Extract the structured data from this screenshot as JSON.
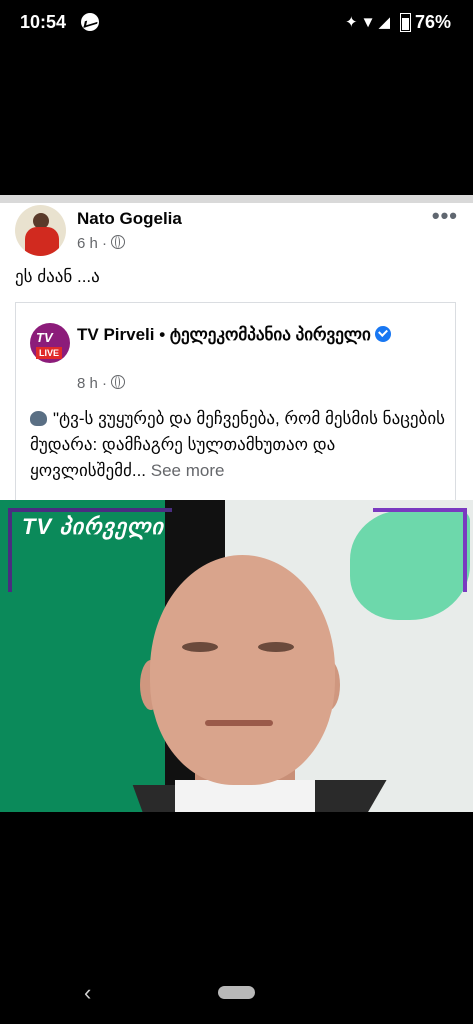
{
  "status_bar": {
    "time": "10:54",
    "battery": "76%"
  },
  "post": {
    "author": "Nato Gogelia",
    "time": "6 h ·",
    "text": "ეს ძაან ...ა",
    "shared": {
      "page_name": "TV Pirveli • ტელეკომპანია პირველი",
      "time": "8 h ·",
      "text": "\"ტვ-ს ვუყურებ და მეჩვენება, რომ მესმის ნაცების მუდარა: დამჩაგრე სულთამხუთაო და ყოვლისშემძ...",
      "see_more": "See more",
      "avatar_text": "TV",
      "avatar_badge": "LIVE"
    }
  },
  "photo": {
    "logo_text": "TV პირველი"
  },
  "nav": {
    "back_glyph": "‹"
  }
}
